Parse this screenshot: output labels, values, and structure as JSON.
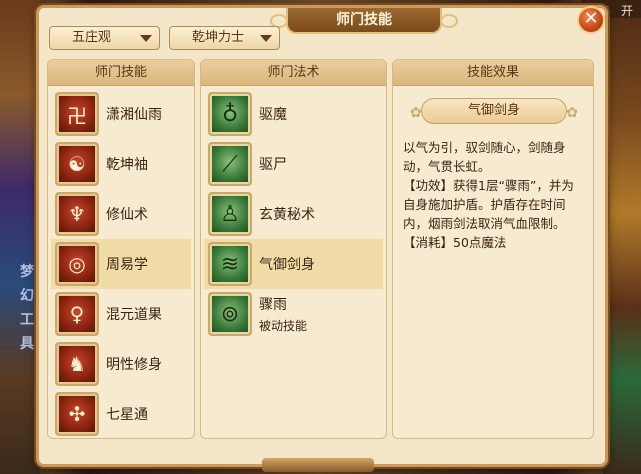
{
  "window": {
    "title": "师门技能",
    "close_icon": "✕"
  },
  "background": {
    "top_right_text": "离 开",
    "left_glyphs": [
      "梦",
      "幻",
      "工",
      "具"
    ]
  },
  "filters": {
    "school": "五庄观",
    "title_rank": "乾坤力士"
  },
  "panels": {
    "skills_header": "师门技能",
    "spells_header": "师门法术",
    "effects_header": "技能效果"
  },
  "skills": [
    {
      "label": "潇湘仙雨",
      "icon": "scroll-rune-icon",
      "glyph": "卍",
      "selected": false
    },
    {
      "label": "乾坤袖",
      "icon": "sleeve-swirl-icon",
      "glyph": "☯",
      "selected": false
    },
    {
      "label": "修仙术",
      "icon": "immortal-figure-icon",
      "glyph": "♆",
      "selected": false
    },
    {
      "label": "周易学",
      "icon": "yijing-circle-icon",
      "glyph": "◎",
      "selected": true
    },
    {
      "label": "混元道果",
      "icon": "dao-fruit-icon",
      "glyph": "♀",
      "selected": false
    },
    {
      "label": "明性修身",
      "icon": "seated-sage-icon",
      "glyph": "♞",
      "selected": false
    },
    {
      "label": "七星通",
      "icon": "seven-stars-icon",
      "glyph": "✣",
      "selected": false
    }
  ],
  "spells": [
    {
      "label": "驱魔",
      "sub": "",
      "icon": "gourd-icon",
      "glyph": "♁",
      "selected": false
    },
    {
      "label": "驱尸",
      "sub": "",
      "icon": "sickle-icon",
      "glyph": "⟋",
      "selected": false
    },
    {
      "label": "玄黄秘术",
      "sub": "",
      "icon": "meditation-icon",
      "glyph": "♙",
      "selected": false
    },
    {
      "label": "气御剑身",
      "sub": "",
      "icon": "sword-wind-icon",
      "glyph": "≋",
      "selected": true
    },
    {
      "label": "骤雨",
      "sub": "被动技能",
      "icon": "rain-target-icon",
      "glyph": "⊚",
      "selected": false
    }
  ],
  "effect": {
    "name": "气御剑身",
    "description": "以气为引，驭剑随心，剑随身动，气贯长虹。",
    "effect_line": "【功效】获得1层“骤雨”，并为自身施加护盾。护盾存在时间内，烟雨剑法取消气血限制。",
    "cost_line": "【消耗】50点魔法"
  },
  "colors": {
    "accent": "#c99a5a",
    "panel_bg": "#f4e7c9",
    "selected_row": "#f1dca8",
    "close_button": "#c8461a"
  }
}
